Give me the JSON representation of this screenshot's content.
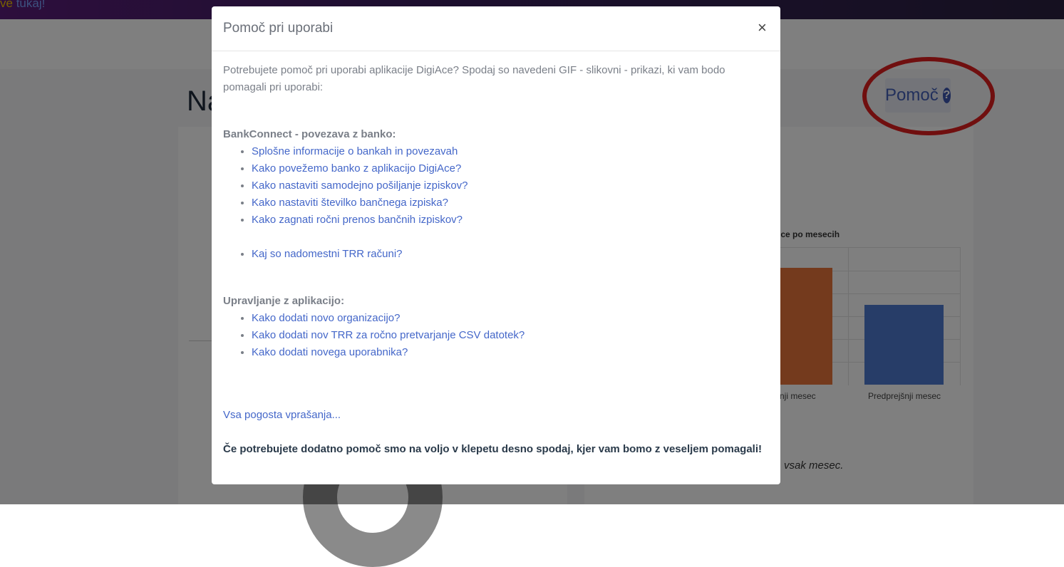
{
  "topbar": {
    "text": "ve",
    "link": "tukaj!"
  },
  "page": {
    "title": "Na"
  },
  "help_button": {
    "label": "Pomoč",
    "icon": "question-circle-icon"
  },
  "chart": {
    "chart_data": {
      "type": "bar",
      "title": "ice po mesecih",
      "categories": [
        "šnji mesec",
        "Predprejšnji mesec"
      ],
      "series": [
        {
          "values": [
            93,
            63
          ]
        }
      ],
      "ylim": [
        0,
        110
      ]
    }
  },
  "background_note": "vsak mesec.",
  "modal": {
    "title": "Pomoč pri uporabi",
    "close": "×",
    "intro": "Potrebujete pomoč pri uporabi aplikacije DigiAce? Spodaj so navedeni GIF - slikovni - prikazi, ki vam bodo pomagali pri uporabi:",
    "bank_section_title": "BankConnect - povezava z banko:",
    "bank_links": [
      "Splošne informacije o bankah in povezavah",
      "Kako povežemo banko z aplikacijo DigiAce?",
      "Kako nastaviti samodejno pošiljanje izpiskov?",
      "Kako nastaviti številko bančnega izpiska?",
      "Kako zagnati ročni prenos bančnih izpiskov?"
    ],
    "bank_extra_link": "Kaj so nadomestni TRR računi?",
    "app_section_title": "Upravljanje z aplikacijo:",
    "app_links": [
      "Kako dodati novo organizacijo?",
      "Kako dodati nov TRR za ročno pretvarjanje CSV datotek?",
      "Kako dodati novega uporabnika?"
    ],
    "faq_link": "Vsa pogosta vprašanja...",
    "footer_note": "Če potrebujete dodatno pomoč smo na voljo v klepetu desno spodaj, kjer vam bomo z veseljem pomagali!"
  },
  "colors": {
    "accent": "#4467c9",
    "annotation": "#e01f1f",
    "bar_orange": "#e8743b",
    "bar_blue": "#4f7bd0"
  }
}
